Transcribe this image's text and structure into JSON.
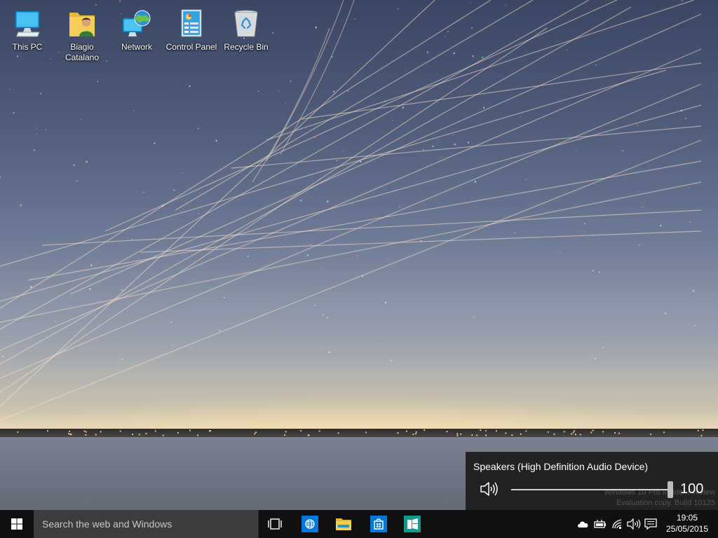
{
  "desktop": {
    "icons": [
      {
        "label": "This PC"
      },
      {
        "label": "Biagio\nCatalano"
      },
      {
        "label": "Network"
      },
      {
        "label": "Control Panel"
      },
      {
        "label": "Recycle Bin"
      }
    ]
  },
  "volume_flyout": {
    "device_name": "Speakers (High Definition Audio Device)",
    "volume_value": "100",
    "volume_level_percent": 100,
    "watermark_line1": "Windows 10 Pro Insider Preview",
    "watermark_line2": "Evaluation copy. Build 10125"
  },
  "taskbar": {
    "search_placeholder": "Search the web and Windows",
    "pinned": [
      {
        "icon": "task-view-icon"
      },
      {
        "icon": "browser-globe-icon"
      },
      {
        "icon": "file-explorer-icon"
      },
      {
        "icon": "store-icon"
      },
      {
        "icon": "app-tile-icon"
      }
    ],
    "tray": [
      "onedrive-cloud-icon",
      "battery-icon",
      "wifi-icon",
      "volume-icon",
      "action-center-icon"
    ],
    "clock": {
      "time": "19:05",
      "date": "25/05/2015"
    }
  },
  "colors": {
    "taskbar": "#101010",
    "search": "#3c3c3c",
    "accent": "#0078d7",
    "flyout": "#1f1f1f"
  }
}
